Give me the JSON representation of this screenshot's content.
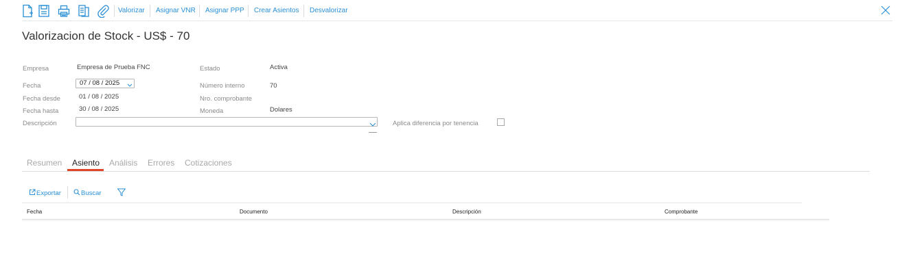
{
  "toolbar": {
    "icons": [
      "new-document-icon",
      "save-icon",
      "print-icon",
      "report-icon",
      "attach-icon"
    ],
    "buttons": {
      "valorizar": "Valorizar",
      "asignar_vnr": "Asignar VNR",
      "asignar_ppp": "Asignar PPP",
      "crear_asientos": "Crear Asientos",
      "desvalorizar": "Desvalorizar"
    }
  },
  "page": {
    "title": "Valorizacion de Stock - US$ - 70"
  },
  "form": {
    "empresa": {
      "label": "Empresa",
      "value": "Empresa de Prueba FNC"
    },
    "fecha": {
      "label": "Fecha",
      "value": "07 / 08 /  2025"
    },
    "fecha_desde": {
      "label": "Fecha desde",
      "value": "01 / 08 /  2025"
    },
    "fecha_hasta": {
      "label": "Fecha hasta",
      "value": "30 / 08 /  2025"
    },
    "descripcion": {
      "label": "Descripción",
      "value": ""
    },
    "estado": {
      "label": "Estado",
      "value": "Activa"
    },
    "numero_interno": {
      "label": "Número interno",
      "value": "70"
    },
    "nro_comprobante": {
      "label": "Nro. comprobante",
      "value": ""
    },
    "moneda": {
      "label": "Moneda",
      "value": "Dolares"
    },
    "aplica_diferencia": {
      "label": "Aplica diferencia por tenencia",
      "checked": false
    }
  },
  "tabs": [
    {
      "label": "Resumen",
      "active": false
    },
    {
      "label": "Asiento",
      "active": true
    },
    {
      "label": "Análisis",
      "active": false
    },
    {
      "label": "Errores",
      "active": false
    },
    {
      "label": "Cotizaciones",
      "active": false
    }
  ],
  "actions": {
    "exportar": "Exportar",
    "buscar": "Buscar"
  },
  "table": {
    "columns": [
      "Fecha",
      "Documento",
      "Descripción",
      "Comprobante"
    ],
    "rows": []
  },
  "colors": {
    "accent": "#2a8fd4",
    "active_tab_underline": "#e0452a"
  }
}
